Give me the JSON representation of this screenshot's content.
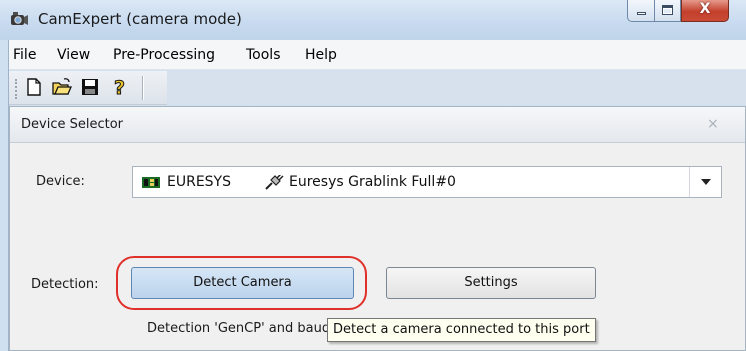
{
  "window": {
    "title": "CamExpert (camera mode)",
    "minimize_icon": "minimize-icon",
    "maximize_icon": "maximize-icon",
    "close_label": "X"
  },
  "menu": {
    "items": [
      {
        "label": "File"
      },
      {
        "label": "View"
      },
      {
        "label": "Pre-Processing"
      },
      {
        "label": "Tools"
      },
      {
        "label": "Help"
      }
    ]
  },
  "toolbar": {
    "buttons": [
      "new-file-icon",
      "open-folder-icon",
      "save-disk-icon",
      "help-icon"
    ],
    "help_glyph": "?"
  },
  "device_selector": {
    "title": "Device Selector",
    "close_glyph": "×",
    "device_label": "Device:",
    "device_vendor": "EURESYS",
    "device_model": "Euresys Grablink Full#0",
    "detection_label": "Detection:",
    "detect_button": "Detect Camera",
    "settings_button": "Settings",
    "detection_status": "Detection 'GenCP' and baudr",
    "tooltip": "Detect a camera connected to this port"
  },
  "colors": {
    "highlight_ring": "#e0302a",
    "detect_button_bg": "#c9dcf1",
    "titlebar_bg": "#cfe0f1",
    "close_button": "#c94b35"
  }
}
